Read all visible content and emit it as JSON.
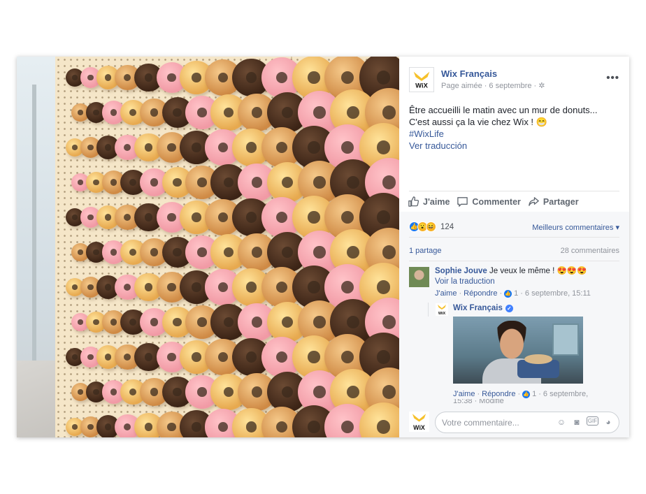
{
  "post": {
    "page_name": "Wix Français",
    "meta_label": "Page aimée",
    "meta_date": "6 septembre",
    "more_label": "•••",
    "text_line1": "Être accueilli le matin avec un mur de donuts...",
    "text_line2": "C'est aussi ça la vie chez Wix ! 😁",
    "hashtag": "#WixLife",
    "translate_link": "Ver traducción"
  },
  "actions": {
    "like": "J'aime",
    "comment": "Commenter",
    "share": "Partager"
  },
  "feedback": {
    "reaction_count": "124",
    "best_comments": "Meilleurs commentaires",
    "shares": "1 partage",
    "comments_count": "28 commentaires"
  },
  "comment1": {
    "author": "Sophie Jouve",
    "text": "Je veux le même ! 😍😍😍",
    "see_translation": "Voir la traduction",
    "like": "J'aime",
    "reply": "Répondre",
    "like_count": "1",
    "timestamp": "6 septembre, 15:11"
  },
  "reply1": {
    "author": "Wix Français",
    "like": "J'aime",
    "reply": "Répondre",
    "like_count": "1",
    "timestamp": "6 septembre,",
    "cut_text": "15:38 · Modifié"
  },
  "composer": {
    "placeholder": "Votre commentaire..."
  },
  "colors": {
    "link": "#365899",
    "like_blue": "#1877f2",
    "muted": "#90949c"
  },
  "icons": [
    "more-icon",
    "gear-icon",
    "like-icon",
    "comment-icon",
    "share-icon",
    "like-reaction-icon",
    "wow-reaction-icon",
    "haha-reaction-icon",
    "verified-icon",
    "emoji-icon",
    "camera-icon",
    "gif-icon",
    "sticker-icon"
  ]
}
